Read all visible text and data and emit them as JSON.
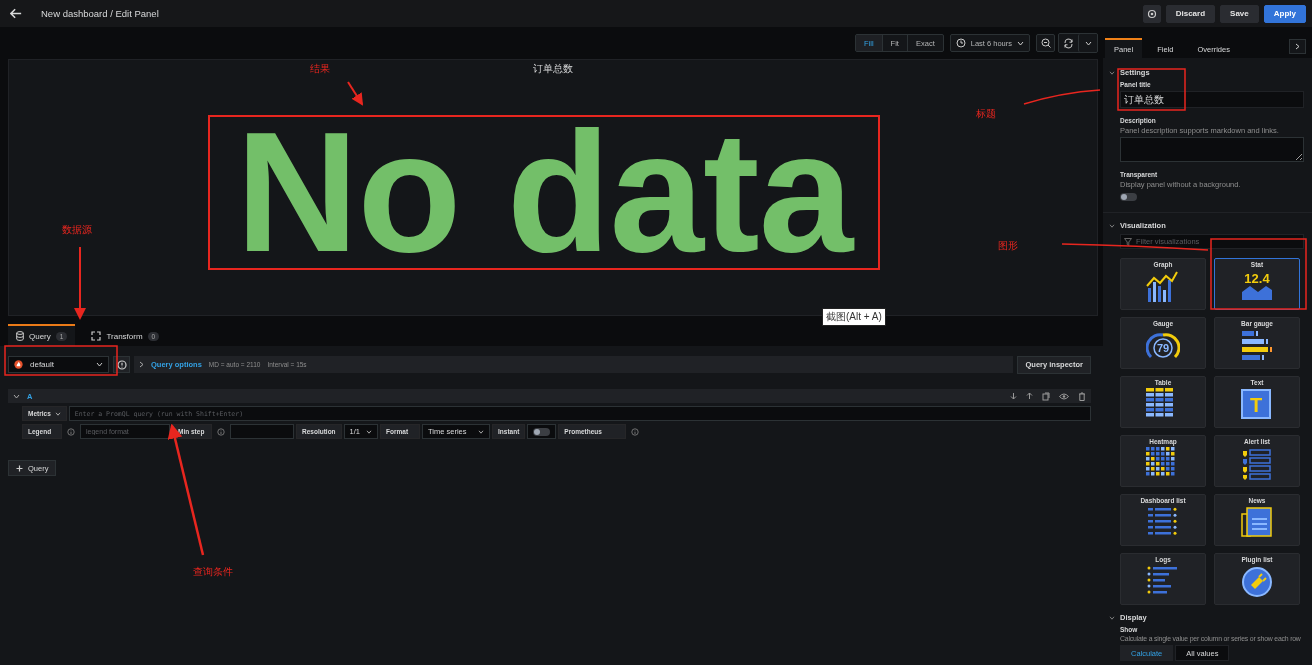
{
  "header": {
    "title": "New dashboard / Edit Panel",
    "buttons": [
      {
        "label": "Discard",
        "kind": "secondary"
      },
      {
        "label": "Save",
        "kind": "secondary"
      },
      {
        "label": "Apply",
        "kind": "primary"
      }
    ]
  },
  "toolbar": {
    "view_modes": [
      {
        "label": "Fill",
        "selected": true
      },
      {
        "label": "Fit",
        "selected": false
      },
      {
        "label": "Exact",
        "selected": false
      }
    ],
    "time_range": "Last 6 hours"
  },
  "panel": {
    "title": "订单总数",
    "message": "No data"
  },
  "query_tabs": [
    {
      "label": "Query",
      "count": "1",
      "selected": true
    },
    {
      "label": "Transform",
      "count": "0",
      "selected": false
    }
  ],
  "tooltip": "截图(Alt + A)",
  "query": {
    "datasource": "default",
    "options_label": "Query options",
    "options_info": [
      "MD = auto = 2110",
      "Interval = 15s"
    ],
    "inspector_button": "Query inspector",
    "row": {
      "ref": "A",
      "metrics_label": "Metrics",
      "placeholder": "Enter a PromQL query (run with Shift+Enter)",
      "legend_label": "Legend",
      "legend_placeholder": "legend format",
      "min_step_label": "Min step",
      "resolution_label": "Resolution",
      "resolution": "1/1",
      "format_label": "Format",
      "format": "Time series",
      "instant_label": "Instant",
      "instant": false,
      "source_label": "Prometheus"
    },
    "add_button": "Query"
  },
  "sidebar": {
    "tabs": [
      {
        "label": "Panel",
        "selected": true
      },
      {
        "label": "Field",
        "selected": false
      },
      {
        "label": "Overrides",
        "selected": false
      }
    ],
    "settings": {
      "heading": "Settings",
      "panel_title_label": "Panel title",
      "panel_title": "订单总数",
      "description_label": "Description",
      "description_hint": "Panel description supports markdown and links.",
      "transparent_label": "Transparent",
      "transparent_hint": "Display panel without a background.",
      "transparent": false
    },
    "visualization": {
      "heading": "Visualization",
      "filter_placeholder": "Filter visualizations",
      "items": [
        {
          "name": "Graph",
          "selected": false
        },
        {
          "name": "Stat",
          "selected": true,
          "figure": "12.4"
        },
        {
          "name": "Gauge",
          "selected": false,
          "figure": "79"
        },
        {
          "name": "Bar gauge",
          "selected": false
        },
        {
          "name": "Table",
          "selected": false
        },
        {
          "name": "Text",
          "selected": false,
          "figure": "T"
        },
        {
          "name": "Heatmap",
          "selected": false
        },
        {
          "name": "Alert list",
          "selected": false
        },
        {
          "name": "Dashboard list",
          "selected": false
        },
        {
          "name": "News",
          "selected": false
        },
        {
          "name": "Logs",
          "selected": false
        },
        {
          "name": "Plugin list",
          "selected": false
        }
      ]
    },
    "display": {
      "heading": "Display",
      "show_label": "Show",
      "show_hint": "Calculate a single value per column or series or show each row",
      "options": [
        {
          "label": "Calculate",
          "selected": true
        },
        {
          "label": "All values",
          "selected": false
        }
      ]
    }
  },
  "annotations": [
    {
      "text": "结果"
    },
    {
      "text": "标题"
    },
    {
      "text": "数据源"
    },
    {
      "text": "图形"
    },
    {
      "text": "查询条件"
    }
  ]
}
